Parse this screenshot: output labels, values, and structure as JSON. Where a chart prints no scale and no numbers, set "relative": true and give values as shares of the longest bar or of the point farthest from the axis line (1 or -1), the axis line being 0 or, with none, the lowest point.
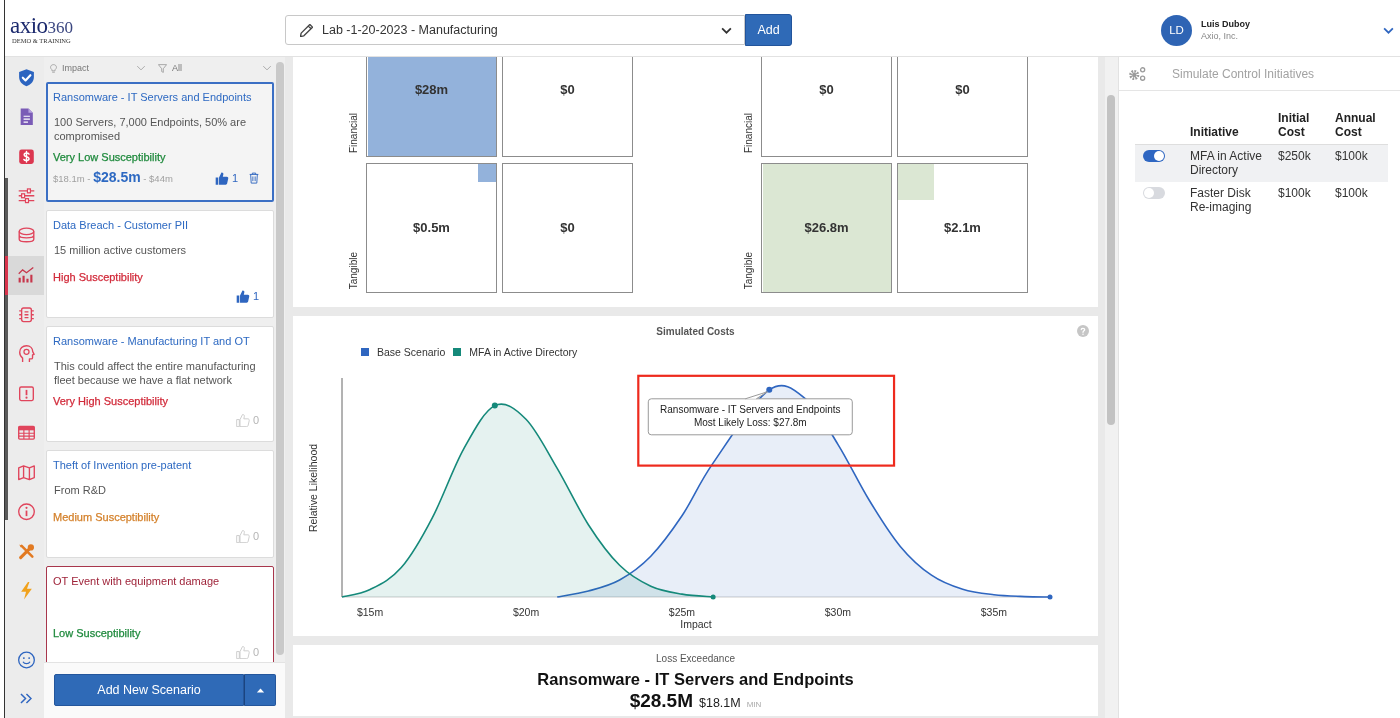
{
  "header": {
    "logo": {
      "name": "axio",
      "version": "360",
      "tagline": "DEMO & TRAINING"
    },
    "assessment": {
      "value": "Lab -1-20-2023 - Manufacturing"
    },
    "add_button": "Add",
    "user": {
      "initials": "LD",
      "name": "Luis Duboy",
      "organization": "Axio, Inc."
    }
  },
  "nav_rail": [
    {
      "selected": false
    },
    {
      "selected": false
    },
    {
      "selected": false
    },
    {
      "selected": false
    },
    {
      "selected": false
    },
    {
      "selected": true
    },
    {
      "selected": false
    },
    {
      "selected": false
    },
    {
      "selected": false
    },
    {
      "selected": false
    },
    {
      "selected": false
    },
    {
      "selected": false
    },
    {
      "selected": false
    },
    {
      "selected": false
    }
  ],
  "scenario_list": {
    "sort": {
      "value": "Impact"
    },
    "filter": {
      "value": "All"
    },
    "scenarios": [
      {
        "title": "Ransomware - IT Servers and Endpoints",
        "description": "100 Servers, 7,000 Endpoints, 50% are compromised",
        "susceptibility": {
          "text": "Very Low Susceptibility",
          "color": "#1f8a3d"
        },
        "range": "$18.1m - **$28.5m** - $44m",
        "likes": "1",
        "liked": true,
        "selected": true,
        "highlighted": false
      },
      {
        "title": "Data Breach - Customer PII",
        "description": "15 million active customers",
        "susceptibility": {
          "text": "High Susceptibility",
          "color": "#d22b3b"
        },
        "likes": "1",
        "liked": true,
        "selected": false,
        "highlighted": false
      },
      {
        "title": "Ransomware - Manufacturing IT and OT",
        "description": "This could affect the entire manufacturing fleet because we have a flat network",
        "susceptibility": {
          "text": "Very High Susceptibility",
          "color": "#d22b3b"
        },
        "likes": "0",
        "liked": false,
        "selected": false,
        "highlighted": false
      },
      {
        "title": "Theft of Invention pre-patent",
        "description": "From R&D",
        "susceptibility": {
          "text": "Medium Susceptibility",
          "color": "#d4812b"
        },
        "likes": "0",
        "liked": false,
        "selected": false,
        "highlighted": false
      },
      {
        "title": "OT Event with equipment damage",
        "susceptibility": {
          "text": "Low Susceptibility",
          "color": "#1f8a3d"
        },
        "likes": "0",
        "liked": false,
        "selected": false,
        "highlighted": true
      }
    ],
    "add_button": "Add New Scenario"
  },
  "matrices": [
    {
      "color": "#93b2db",
      "rows": [
        {
          "label": "Financial",
          "cells": [
            {
              "value": "$28m",
              "level": 1
            },
            {
              "value": "$0"
            }
          ]
        },
        {
          "label": "Tangible",
          "cells": [
            {
              "value": "$0.5m",
              "level": 0.14
            },
            {
              "value": "$0"
            }
          ]
        }
      ]
    },
    {
      "color": "#dbe7d3",
      "rows": [
        {
          "label": "Financial",
          "cells": [
            {
              "value": "$0"
            },
            {
              "value": "$0"
            }
          ]
        },
        {
          "label": "Tangible",
          "cells": [
            {
              "value": "$26.8m",
              "level": 1
            },
            {
              "value": "$2.1m",
              "level": 0.28
            }
          ]
        }
      ]
    }
  ],
  "simulated_costs": {
    "highlight_box": true,
    "chart_data": {
      "type": "area",
      "title": "Simulated Costs",
      "xlabel": "Impact",
      "ylabel": "Relative Likelihood",
      "relative": true,
      "x": [
        14.1,
        15,
        16,
        17,
        18,
        19,
        20,
        21,
        22,
        23,
        24,
        25,
        26,
        27,
        27.8,
        29,
        30,
        31,
        32,
        33,
        34,
        35,
        36,
        36.8
      ],
      "xlim": [
        14.1,
        36.8
      ],
      "xticks": [
        {
          "value": 15,
          "label": "$15m"
        },
        {
          "value": 20,
          "label": "$20m"
        },
        {
          "value": 25,
          "label": "$25m"
        },
        {
          "value": 30,
          "label": "$30m"
        },
        {
          "value": 35,
          "label": "$35m"
        }
      ],
      "series": [
        {
          "name": "Base Scenario",
          "color": "#2f66c0",
          "values": [
            null,
            null,
            null,
            null,
            null,
            null,
            null,
            0,
            0.029,
            0.082,
            0.197,
            0.392,
            0.647,
            null,
            1,
            0.952,
            0.737,
            0.468,
            0.244,
            0.105,
            0.037,
            0.011,
            0.002,
            0
          ]
        },
        {
          "name": "MFA in Active Directory",
          "color": "#15897a",
          "values": [
            0,
            0.036,
            0.142,
            0.383,
            0.714,
            0.924,
            0.858,
            0.621,
            0.349,
            0.153,
            0.052,
            0.014,
            0,
            null,
            null,
            null,
            null,
            null,
            null,
            null,
            null,
            null,
            null,
            null
          ]
        }
      ],
      "annotations": [
        {
          "text": "Ransomware - IT Servers and Endpoints",
          "x": 27.8,
          "y": 1
        },
        {
          "text": "Most Likely Loss: $27.8m",
          "x": 27.8,
          "y": 1
        }
      ]
    }
  },
  "loss_exceedance": {
    "label": "Loss Exceedance",
    "scenario": "Ransomware - IT Servers and Endpoints",
    "likely": "$28.5M",
    "min": "$18.1M",
    "min_label": "MIN"
  },
  "initiatives_panel": {
    "title": "Simulate Control Initiatives",
    "columns": [
      "Initiative",
      "Initial Cost",
      "Annual Cost"
    ],
    "rows": [
      {
        "on": true,
        "name": "MFA in Active Directory",
        "initial_cost": "$250k",
        "annual_cost": "$100k"
      },
      {
        "on": false,
        "name": "Faster Disk Re-imaging",
        "initial_cost": "$100k",
        "annual_cost": "$100k"
      }
    ]
  }
}
